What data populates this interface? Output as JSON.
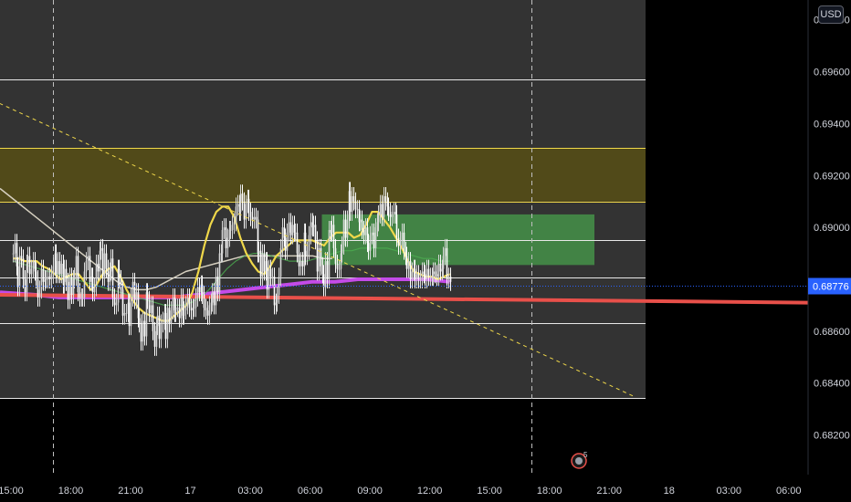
{
  "currency": "USD",
  "chart_data": {
    "type": "line",
    "instrument_quote": "USD",
    "ylim": [
      0.681,
      0.6982
    ],
    "y_ticks": [
      0.682,
      0.684,
      0.686,
      0.688,
      0.689,
      0.69,
      0.692,
      0.694,
      0.696,
      0.698
    ],
    "y_tick_labels": [
      "0.68200",
      "0.68400",
      "0.68600",
      "",
      "0.69000",
      "0.69200",
      "0.69400",
      "0.69600",
      "0.69800"
    ],
    "x_tick_labels": [
      "15:00",
      "18:00",
      "21:00",
      "17",
      "03:00",
      "06:00",
      "09:00",
      "12:00",
      "15:00",
      "18:00",
      "21:00",
      "18",
      "03:00",
      "06:00"
    ],
    "x_ticks_bar": [
      0,
      36,
      72,
      108,
      144,
      180,
      216,
      252,
      288,
      324,
      360,
      396,
      432,
      468
    ],
    "session_breaks_bar": [
      24,
      312
    ],
    "current_price": 0.68776,
    "current_price_label": "0.68776",
    "horizontal_levels": [
      0.69572,
      0.69306,
      0.691,
      0.68952,
      0.68808,
      0.6863,
      0.68344
    ],
    "zones": [
      {
        "name": "supply-zone",
        "from": 0.691,
        "to": 0.69306,
        "color": "#5c5312"
      },
      {
        "name": "consolidation-box",
        "from": 0.68855,
        "to": 0.6905,
        "bar_from": 186,
        "bar_to": 350,
        "color": "#4caf50"
      }
    ],
    "trendline": {
      "from": [
        -8,
        0.69478
      ],
      "to": [
        375,
        0.68345
      ],
      "color": "#f0d84a"
    },
    "candles": [
      0.689,
      0.6894,
      0.6885,
      0.6877,
      0.6889,
      0.6888,
      0.688,
      0.6875,
      0.6886,
      0.6889,
      0.6882,
      0.6884,
      0.6887,
      0.6883,
      0.688,
      0.6873,
      0.6876,
      0.6884,
      0.6879,
      0.688,
      0.688,
      0.6881,
      0.688,
      0.6882,
      0.6885,
      0.689,
      0.6882,
      0.6887,
      0.6882,
      0.6886,
      0.6878,
      0.6884,
      0.6879,
      0.6872,
      0.6881,
      0.6874,
      0.688,
      0.6881,
      0.6889,
      0.6875,
      0.6873,
      0.6873,
      0.6873,
      0.6883,
      0.6887,
      0.6889,
      0.6879,
      0.6881,
      0.6875,
      0.6877,
      0.6886,
      0.6883,
      0.6891,
      0.6892,
      0.6881,
      0.689,
      0.6884,
      0.6879,
      0.6883,
      0.6888,
      0.6873,
      0.687,
      0.6871,
      0.6884,
      0.688,
      0.6876,
      0.6866,
      0.6867,
      0.6867,
      0.6871,
      0.6862,
      0.6873,
      0.6879,
      0.6872,
      0.6875,
      0.6865,
      0.6863,
      0.6856,
      0.6864,
      0.6858,
      0.6875,
      0.6872,
      0.6867,
      0.687,
      0.686,
      0.6854,
      0.6862,
      0.6866,
      0.6857,
      0.6863,
      0.6864,
      0.6867,
      0.6857,
      0.6869,
      0.6863,
      0.6868,
      0.6873,
      0.6867,
      0.6869,
      0.6869,
      0.6865,
      0.6873,
      0.6866,
      0.6868,
      0.687,
      0.6873,
      0.6869,
      0.6868,
      0.6869,
      0.6869,
      0.6873,
      0.6877,
      0.6875,
      0.6878,
      0.6874,
      0.6869,
      0.6868,
      0.6866,
      0.687,
      0.6871,
      0.6875,
      0.687,
      0.6881,
      0.6875,
      0.689,
      0.689,
      0.6899,
      0.69,
      0.6892,
      0.6896,
      0.6899,
      0.6899,
      0.6901,
      0.6902,
      0.6908,
      0.6909,
      0.6906,
      0.6913,
      0.691,
      0.6903,
      0.6909,
      0.6911,
      0.6906,
      0.6904,
      0.6903,
      0.6904,
      0.6903,
      0.689,
      0.6891,
      0.6881,
      0.689,
      0.6883,
      0.6887,
      0.6876,
      0.6884,
      0.6881,
      0.6881,
      0.687,
      0.6871,
      0.6874,
      0.6881,
      0.6892,
      0.69,
      0.6896,
      0.6891,
      0.6898,
      0.6902,
      0.6897,
      0.6901,
      0.6898,
      0.6898,
      0.689,
      0.6885,
      0.6887,
      0.6885,
      0.6898,
      0.6889,
      0.6891,
      0.6897,
      0.6902,
      0.69,
      0.6901,
      0.6895,
      0.6883,
      0.6892,
      0.6885,
      0.6882,
      0.6877,
      0.6887,
      0.688,
      0.6899,
      0.6898,
      0.6901,
      0.6892,
      0.6886,
      0.6884,
      0.6884,
      0.689,
      0.6893,
      0.6903,
      0.6896,
      0.6903,
      0.6914,
      0.6906,
      0.6912,
      0.691,
      0.6907,
      0.6907,
      0.6902,
      0.6903,
      0.6899,
      0.6897,
      0.69,
      0.6894,
      0.6891,
      0.6897,
      0.6898,
      0.6892,
      0.69,
      0.6902,
      0.6905,
      0.6909,
      0.6904,
      0.6912,
      0.691,
      0.6908,
      0.6906,
      0.6904,
      0.6905,
      0.6906,
      0.6905,
      0.6896,
      0.6893,
      0.6895,
      0.6898,
      0.6891,
      0.6889,
      0.6884,
      0.6887,
      0.688,
      0.6883,
      0.6884,
      0.688,
      0.6882,
      0.688,
      0.688,
      0.6883,
      0.6882,
      0.688,
      0.6884,
      0.6881,
      0.6881,
      0.6881,
      0.6883,
      0.6882,
      0.6881,
      0.6886,
      0.6883,
      0.6884,
      0.6889,
      0.6892,
      0.688,
      0.6881,
      0.6879
    ],
    "moving_averages": [
      {
        "name": "fast",
        "color": "#f0d84a",
        "values": [
          0.6888,
          0.6888,
          0.6887,
          0.6887,
          0.6887,
          0.6885,
          0.6884,
          0.6882,
          0.688,
          0.6881,
          0.6882,
          0.6882,
          0.6879,
          0.6876,
          0.6878,
          0.6882,
          0.6884,
          0.6885,
          0.6881,
          0.6876,
          0.6872,
          0.6869,
          0.6867,
          0.6866,
          0.6865,
          0.6864,
          0.6864,
          0.6866,
          0.6868,
          0.687,
          0.6875,
          0.6883,
          0.6893,
          0.6901,
          0.6906,
          0.6908,
          0.6908,
          0.6904,
          0.6896,
          0.689,
          0.6886,
          0.6883,
          0.6882,
          0.6885,
          0.6889,
          0.6891,
          0.6893,
          0.6895,
          0.6895,
          0.6895,
          0.6895,
          0.6894,
          0.6893,
          0.6896,
          0.6898,
          0.6898,
          0.6898,
          0.6896,
          0.6897,
          0.6901,
          0.6906,
          0.6906,
          0.6903,
          0.69,
          0.6896,
          0.6892,
          0.6887,
          0.6883,
          0.6882,
          0.6881,
          0.6881,
          0.688,
          0.6881,
          0.6882
        ]
      },
      {
        "name": "medium",
        "color": "#4caf50",
        "values": [
          0.6887,
          0.6886,
          0.6885,
          0.6884,
          0.6883,
          0.6882,
          0.6881,
          0.688,
          0.6879,
          0.6878,
          0.6877,
          0.6876,
          0.6875,
          0.6874,
          0.6873,
          0.6872,
          0.6871,
          0.687,
          0.687,
          0.687,
          0.6871,
          0.6873,
          0.6876,
          0.688,
          0.6884,
          0.6887,
          0.6889,
          0.689,
          0.689,
          0.6889,
          0.6888,
          0.6887,
          0.6887,
          0.6887,
          0.6888,
          0.6889,
          0.689,
          0.6891,
          0.6891,
          0.6892,
          0.6892,
          0.6892,
          0.6892,
          0.6891,
          0.689,
          0.6889,
          0.6888,
          0.6888,
          0.6887,
          0.6887
        ]
      },
      {
        "name": "slow",
        "color": "#d6d0c0",
        "values": [
          0.6915,
          0.6912,
          0.6909,
          0.6906,
          0.6903,
          0.69,
          0.6897,
          0.6894,
          0.6891,
          0.6888,
          0.6885,
          0.6882,
          0.6879,
          0.6877,
          0.6876,
          0.6876,
          0.6877,
          0.6879,
          0.6881,
          0.6883,
          0.6884,
          0.6885,
          0.6886,
          0.6887,
          0.6888,
          0.6889,
          0.6889,
          0.6889,
          0.6889,
          0.6889,
          0.6889,
          0.6889,
          0.6889,
          0.6888,
          0.6888
        ]
      },
      {
        "name": "long",
        "color": "#c44be8",
        "values": [
          0.6875,
          0.6874,
          0.6873,
          0.6873,
          0.6873,
          0.6873,
          0.6873,
          0.6873,
          0.6874,
          0.6875,
          0.6876,
          0.6877,
          0.6878,
          0.6879,
          0.6879,
          0.688,
          0.688,
          0.688,
          0.688,
          0.6879
        ]
      },
      {
        "name": "longest",
        "color": "#e8504a",
        "values": [
          0.6874,
          0.6871
        ]
      }
    ],
    "event_marker": {
      "count": "5",
      "bar": 341
    }
  }
}
